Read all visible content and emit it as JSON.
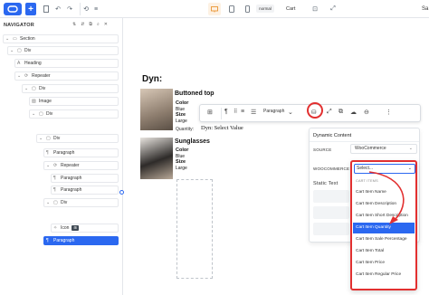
{
  "toolbar": {
    "breakpoint_label": "normal",
    "page_label": "Cart",
    "right_label": "Sa",
    "accent_color": "#2b68f0"
  },
  "navigator": {
    "title": "NAVIGATOR",
    "tree": [
      {
        "label": "Section",
        "icon": "section-icon"
      },
      {
        "label": "Div",
        "icon": "div-icon"
      },
      {
        "label": "Heading",
        "icon": "heading-icon"
      },
      {
        "label": "Repeater",
        "icon": "repeater-icon"
      },
      {
        "label": "Div",
        "icon": "div-icon"
      },
      {
        "label": "Image",
        "icon": "image-icon"
      },
      {
        "label": "Div",
        "icon": "div-icon"
      },
      {
        "label": "Div",
        "icon": "div-icon"
      },
      {
        "label": "Paragraph",
        "icon": "paragraph-icon"
      },
      {
        "label": "Repeater",
        "icon": "repeater-icon"
      },
      {
        "label": "Paragraph",
        "icon": "paragraph-icon"
      },
      {
        "label": "Paragraph",
        "icon": "paragraph-icon"
      },
      {
        "label": "Div",
        "icon": "div-icon"
      },
      {
        "label": "Icon",
        "icon": "icon-element-icon",
        "tag": "⊞"
      },
      {
        "label": "Paragraph",
        "icon": "paragraph-icon"
      }
    ]
  },
  "canvas": {
    "heading": "Dyn:",
    "products": [
      {
        "title": "Buttoned top",
        "color_label": "Color",
        "color_value": "Blue",
        "size_label": "Size",
        "size_value": "Large"
      },
      {
        "title": "Sunglasses",
        "color_label": "Color",
        "color_value": "Blue",
        "size_label": "Size",
        "size_value": "Large"
      }
    ],
    "quantity_label": "Quantity:",
    "quantity_value": "Dyn: Select Value"
  },
  "element_toolbar": {
    "paragraph_label": "Paragraph"
  },
  "dynamic_panel": {
    "title": "Dynamic Content",
    "source_label": "SOURCE",
    "source_value": "WooCommerce",
    "woo_label": "WOOCOMMERCE",
    "static_text_label": "Static Text"
  },
  "dropdown": {
    "placeholder": "Select...",
    "group_label": "CART ITEMS",
    "options": [
      "Cart Item Name",
      "Cart Item Description",
      "Cart Item Short Description",
      "Cart Item Quantity",
      "Cart Item Sale Percentage",
      "Cart Item Total",
      "Cart Item Price",
      "Cart Item Regular Price"
    ],
    "highlighted_index": 3,
    "highlight_color": "#2b68f0",
    "annotation_color": "#e23030"
  }
}
